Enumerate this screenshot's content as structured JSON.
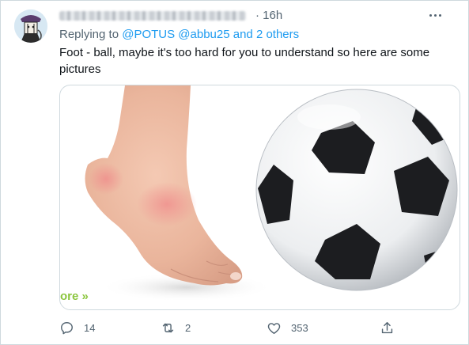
{
  "tweet": {
    "time": "16h",
    "replying_prefix": "Replying to ",
    "replying_mentions": "@POTUS @abbu25",
    "replying_suffix": " and 2 others",
    "text": "Foot - ball, maybe it's too hard for you to understand so here are some pictures",
    "media": {
      "overlay_link": "ore »",
      "images": [
        "foot-photo",
        "soccer-ball-photo"
      ]
    },
    "actions": {
      "reply_count": "14",
      "retweet_count": "2",
      "like_count": "353"
    },
    "colors": {
      "link": "#1d9bf0",
      "muted": "#536471",
      "text": "#0f1419",
      "overlay_link": "#8cc63f"
    }
  }
}
